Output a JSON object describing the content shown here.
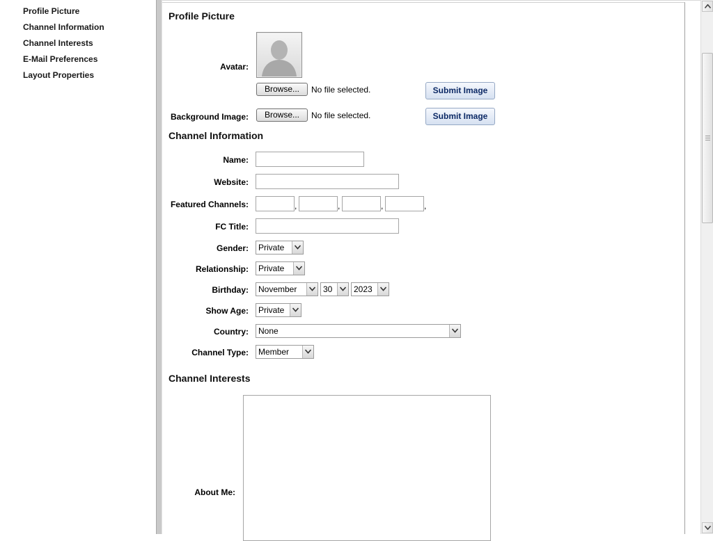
{
  "sidebar": {
    "items": [
      {
        "label": "Profile Picture"
      },
      {
        "label": "Channel Information"
      },
      {
        "label": "Channel Interests"
      },
      {
        "label": "E-Mail Preferences"
      },
      {
        "label": "Layout Properties"
      }
    ]
  },
  "profile_picture": {
    "title": "Profile Picture",
    "avatar_label": "Avatar:",
    "background_label": "Background Image:",
    "browse_label": "Browse...",
    "no_file_text": "No file selected.",
    "submit_label": "Submit Image"
  },
  "channel_info": {
    "title": "Channel Information",
    "name_label": "Name:",
    "name_value": "",
    "website_label": "Website:",
    "website_value": "",
    "featured_label": "Featured Channels:",
    "featured_sep": ",",
    "fc_title_label": "FC Title:",
    "fc_title_value": "",
    "gender_label": "Gender:",
    "gender_value": "Private",
    "relationship_label": "Relationship:",
    "relationship_value": "Private",
    "birthday_label": "Birthday:",
    "birthday_month": "November",
    "birthday_day": "30",
    "birthday_year": "2023",
    "show_age_label": "Show Age:",
    "show_age_value": "Private",
    "country_label": "Country:",
    "country_value": "None",
    "channel_type_label": "Channel Type:",
    "channel_type_value": "Member"
  },
  "channel_interests": {
    "title": "Channel Interests",
    "about_me_label": "About Me:",
    "about_me_value": ""
  }
}
